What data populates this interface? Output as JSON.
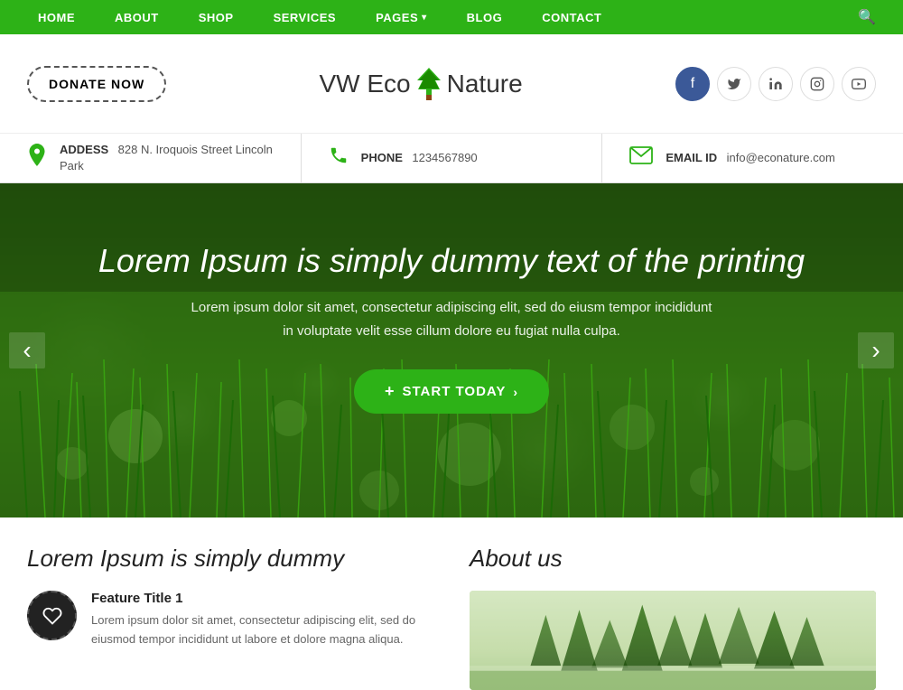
{
  "nav": {
    "items": [
      {
        "label": "HOME",
        "id": "home",
        "hasDropdown": false
      },
      {
        "label": "ABOUT",
        "id": "about",
        "hasDropdown": false
      },
      {
        "label": "SHOP",
        "id": "shop",
        "hasDropdown": false
      },
      {
        "label": "SERVICES",
        "id": "services",
        "hasDropdown": false
      },
      {
        "label": "PAGES",
        "id": "pages",
        "hasDropdown": true
      },
      {
        "label": "BLOG",
        "id": "blog",
        "hasDropdown": false
      },
      {
        "label": "CONTACT",
        "id": "contact",
        "hasDropdown": false
      }
    ]
  },
  "header": {
    "donate_btn": "DONATE NOW",
    "logo_name": "VW Eco Nature",
    "logo_vw": "VW Eco",
    "logo_nature": "Nature"
  },
  "social": {
    "facebook": "f",
    "twitter": "t",
    "linkedin": "in",
    "instagram": "◻",
    "youtube": "▶"
  },
  "infobar": {
    "address_label": "ADDESS",
    "address_value": "828 N. Iroquois Street Lincoln Park",
    "phone_label": "PHONE",
    "phone_value": "1234567890",
    "email_label": "EMAIL ID",
    "email_value": "info@econature.com"
  },
  "hero": {
    "title": "Lorem Ipsum is simply dummy text of the printing",
    "subtitle_line1": "Lorem ipsum dolor sit amet, consectetur adipiscing elit, sed do eiusm tempor incididunt",
    "subtitle_line2": "in voluptate velit esse cillum dolore eu fugiat nulla culpa.",
    "btn_label": "START TODAY",
    "btn_plus": "+",
    "btn_arrow": "›"
  },
  "lower": {
    "left_title": "Lorem Ipsum is simply dummy",
    "feature": {
      "title": "Feature Title 1",
      "text": "Lorem ipsum dolor sit amet, consectetur adipiscing elit, sed do eiusmod tempor incididunt ut labore et dolore magna aliqua."
    },
    "right_title": "About us"
  }
}
